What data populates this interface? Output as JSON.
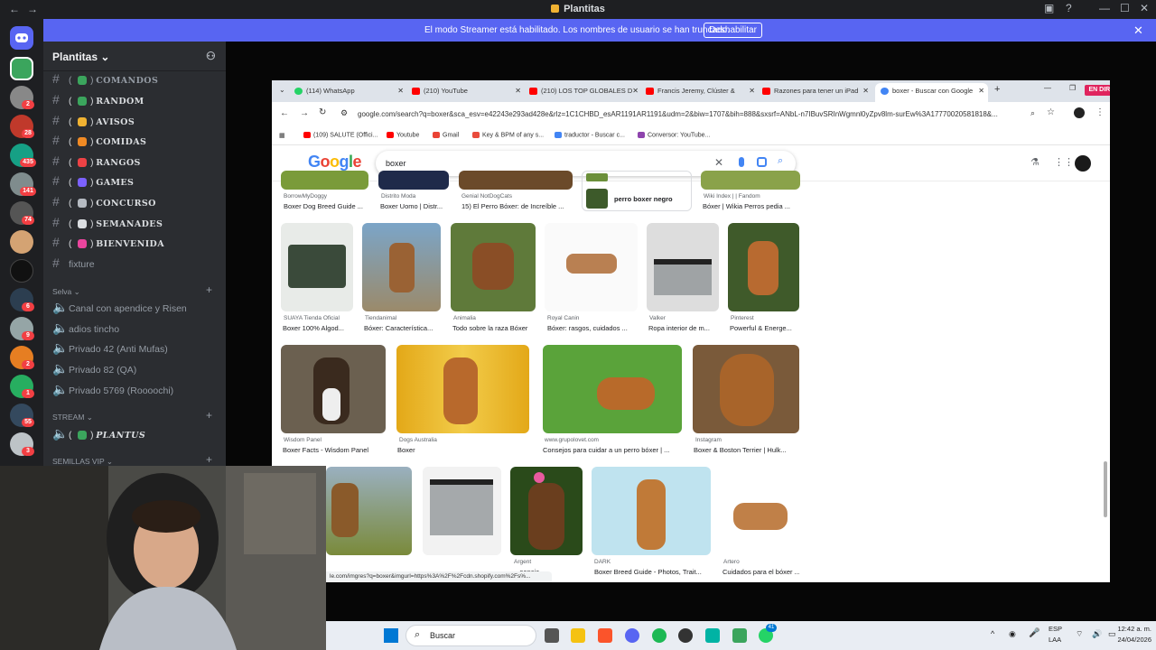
{
  "app": {
    "title": "Plantitas",
    "colors": {
      "discord_bg": "#1e1f22",
      "sidebar_bg": "#2b2d31",
      "banner": "#5865f2",
      "google_blue": "#4285f4",
      "live_red": "#e0245e"
    }
  },
  "banner": {
    "message": "El modo Streamer está habilitado. Los nombres de usuario se han truncado.",
    "disable_label": "Deshabilitar",
    "close_icon": "close-icon"
  },
  "server_rail": {
    "badges": [
      "2",
      "28",
      "435",
      "141",
      "74",
      "6",
      "9",
      "2",
      "1",
      "55",
      "3"
    ]
  },
  "sidebar": {
    "server_name": "Plantitas",
    "channels": [
      {
        "name": "COMANDOS",
        "style": "fancy",
        "color": "#3ba55d"
      },
      {
        "name": "RANDOM",
        "style": "fancy",
        "color": "#3ba55d"
      },
      {
        "name": "AVISOS",
        "style": "fancy",
        "color": "#f0b232"
      },
      {
        "name": "COMIDAS",
        "style": "fancy",
        "color": "#f08a24"
      },
      {
        "name": "RANGOS",
        "style": "fancy",
        "color": "#ed4245"
      },
      {
        "name": "GAMES",
        "style": "fancy",
        "color": "#7b61ff"
      },
      {
        "name": "CONCURSO",
        "style": "fancy",
        "color": "#b5bac1"
      },
      {
        "name": "SEMANADES",
        "style": "fancy",
        "color": "#dbdee1"
      },
      {
        "name": "BIENVENIDA",
        "style": "fancy",
        "color": "#eb459e"
      },
      {
        "name": "fixture",
        "style": "plain",
        "color": "#80848e"
      }
    ],
    "category_selva": "Selva",
    "voice_channels": [
      "Canal con apendice y Risen",
      "adios tincho",
      "Privado 42 (Anti Mufas)",
      "Privado 82 (QA)",
      "Privado 5769 (Roooochi)"
    ],
    "category_stream": "STREAM",
    "stream_channel": "PLANTUS",
    "category_semillas": "SEMILLAS VIP"
  },
  "browser": {
    "tabs": [
      {
        "label": "(114) WhatsApp",
        "color": "#25d366",
        "active": false
      },
      {
        "label": "(210) YouTube",
        "color": "#ff0000",
        "active": false
      },
      {
        "label": "(210) LOS TOP GLOBALES D",
        "color": "#ff0000",
        "active": false
      },
      {
        "label": "Francis Jeremy, Clúster & ",
        "color": "#ff0000",
        "active": false
      },
      {
        "label": "Razones para tener un iPad",
        "color": "#ff0000",
        "active": false
      },
      {
        "label": "boxer - Buscar con Google",
        "color": "#4285f4",
        "active": true
      }
    ],
    "live_badge": "EN DIRECTO",
    "url": "google.com/search?q=boxer&sca_esv=e42243e293ad428e&rlz=1C1CHBD_esAR1191AR1191&udm=2&biw=1707&bih=888&sxsrf=ANbL-n7IBuvSRInWgmnl0yZpv8lm-surEw%3A17770020581818&...",
    "bookmarks": [
      {
        "label": "(109) SALUTE (Offici...",
        "color": "#ff0000"
      },
      {
        "label": "Youtube",
        "color": "#ff0000"
      },
      {
        "label": "Gmail",
        "color": "#ea4335"
      },
      {
        "label": "Key & BPM of any s...",
        "color": "#e94b3c"
      },
      {
        "label": "traductor - Buscar c...",
        "color": "#4285f4"
      },
      {
        "label": "Conversor: YouTube...",
        "color": "#8e44ad"
      }
    ],
    "search_query": "boxer",
    "status_url": "le.com/imgres?q=boxer&imgurl=https%3A%2F%2Fcdn.shopify.com%2Fs%..."
  },
  "results": {
    "row0": [
      {
        "source": "BorrowMyDoggy",
        "caption": "Boxer Dog Breed Guide ..."
      },
      {
        "source": "Distrito Moda",
        "caption": "Boxer Uomo | Distr..."
      },
      {
        "source": "Genial NotDogCats",
        "caption": "15) El Perro Bóxer: de Increíble ..."
      },
      {
        "source": "Wiki Index | | Fandom",
        "caption": "Bóxer | Wikia Perros pedia ..."
      }
    ],
    "related": "perro boxer negro",
    "row1": [
      {
        "source": "SUAYA Tienda Oficial",
        "caption": "Boxer 100% Algod..."
      },
      {
        "source": "Tiendanimal",
        "caption": "Bóxer: Característica..."
      },
      {
        "source": "Animalia",
        "caption": "Todo sobre la raza Bóxer"
      },
      {
        "source": "Royal Canin",
        "caption": "Bóxer: rasgos, cuidados ..."
      },
      {
        "source": "Valker",
        "caption": "Ropa interior de m..."
      },
      {
        "source": "Pinterest",
        "caption": "Powerful & Energe..."
      }
    ],
    "row2": [
      {
        "source": "Wisdom Panel",
        "caption": "Boxer Facts - Wisdom Panel"
      },
      {
        "source": "Dogs Australia",
        "caption": "Boxer"
      },
      {
        "source": "www.grupolovet.com",
        "caption": "Consejos para cuidar a un perro bóxer | ..."
      },
      {
        "source": "Instagram",
        "caption": "Boxer & Boston Terrier | Hulk..."
      }
    ],
    "row3": [
      {
        "source": "Argent",
        "caption": "...oencia"
      },
      {
        "source": "DARK",
        "caption": "Boxer Breed Guide - Photos, Trait..."
      },
      {
        "source": "Artero",
        "caption": "Cuidados para el bóxer ..."
      }
    ]
  },
  "taskbar": {
    "search_label": "Buscar",
    "lang": "ESP",
    "lang2": "LAA",
    "time": "12:42 a. m.",
    "date": "24/04/2026",
    "badge1": "41"
  }
}
